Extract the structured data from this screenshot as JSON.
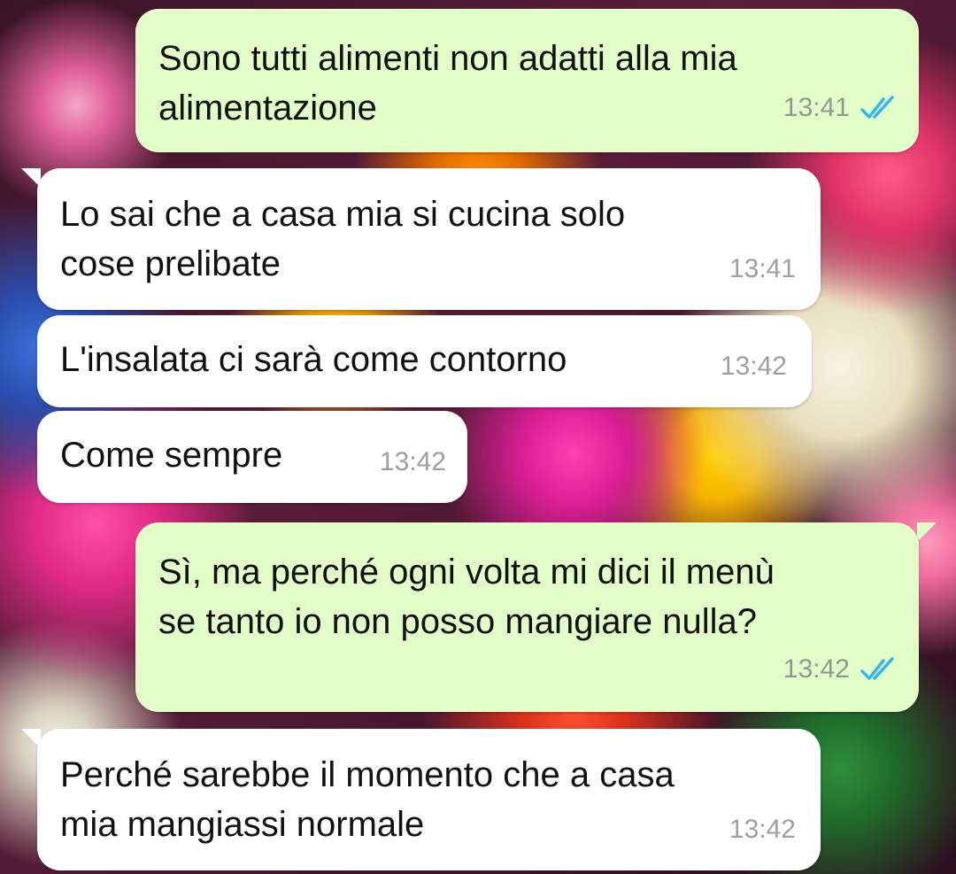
{
  "messages": [
    {
      "direction": "outgoing",
      "text": "Sono tutti alimenti non adatti alla mia\nalimentazione",
      "time": "13:41",
      "status": "read"
    },
    {
      "direction": "incoming",
      "text": "Lo sai che a casa mia si cucina solo\ncose prelibate",
      "time": "13:41"
    },
    {
      "direction": "incoming",
      "text": "L'insalata ci sarà come contorno",
      "time": "13:42"
    },
    {
      "direction": "incoming",
      "text": "Come sempre",
      "time": "13:42"
    },
    {
      "direction": "outgoing",
      "text": "Sì, ma perché ogni volta mi dici il menù\nse tanto io non posso mangiare nulla?",
      "time": "13:42",
      "status": "read"
    },
    {
      "direction": "incoming",
      "text": "Perché sarebbe il momento che a casa\nmia mangiassi normale",
      "time": "13:42"
    }
  ],
  "colors": {
    "outgoing_bubble": "#e2fdc8",
    "incoming_bubble": "#ffffff",
    "read_ticks": "#34b7f1",
    "timestamp": "#8f9a92"
  },
  "icons": {
    "read_receipt": "double-check-icon"
  }
}
